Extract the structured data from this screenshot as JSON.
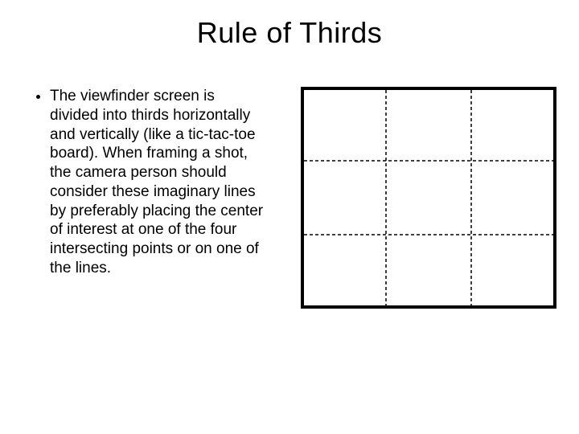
{
  "title": "Rule of Thirds",
  "bullet": "The viewfinder screen is divided into thirds horizontally and vertically (like a tic-tac-toe board).  When framing a shot, the camera person should consider these imaginary lines by preferably placing the center of interest at one of the four intersecting points or on one of the lines."
}
